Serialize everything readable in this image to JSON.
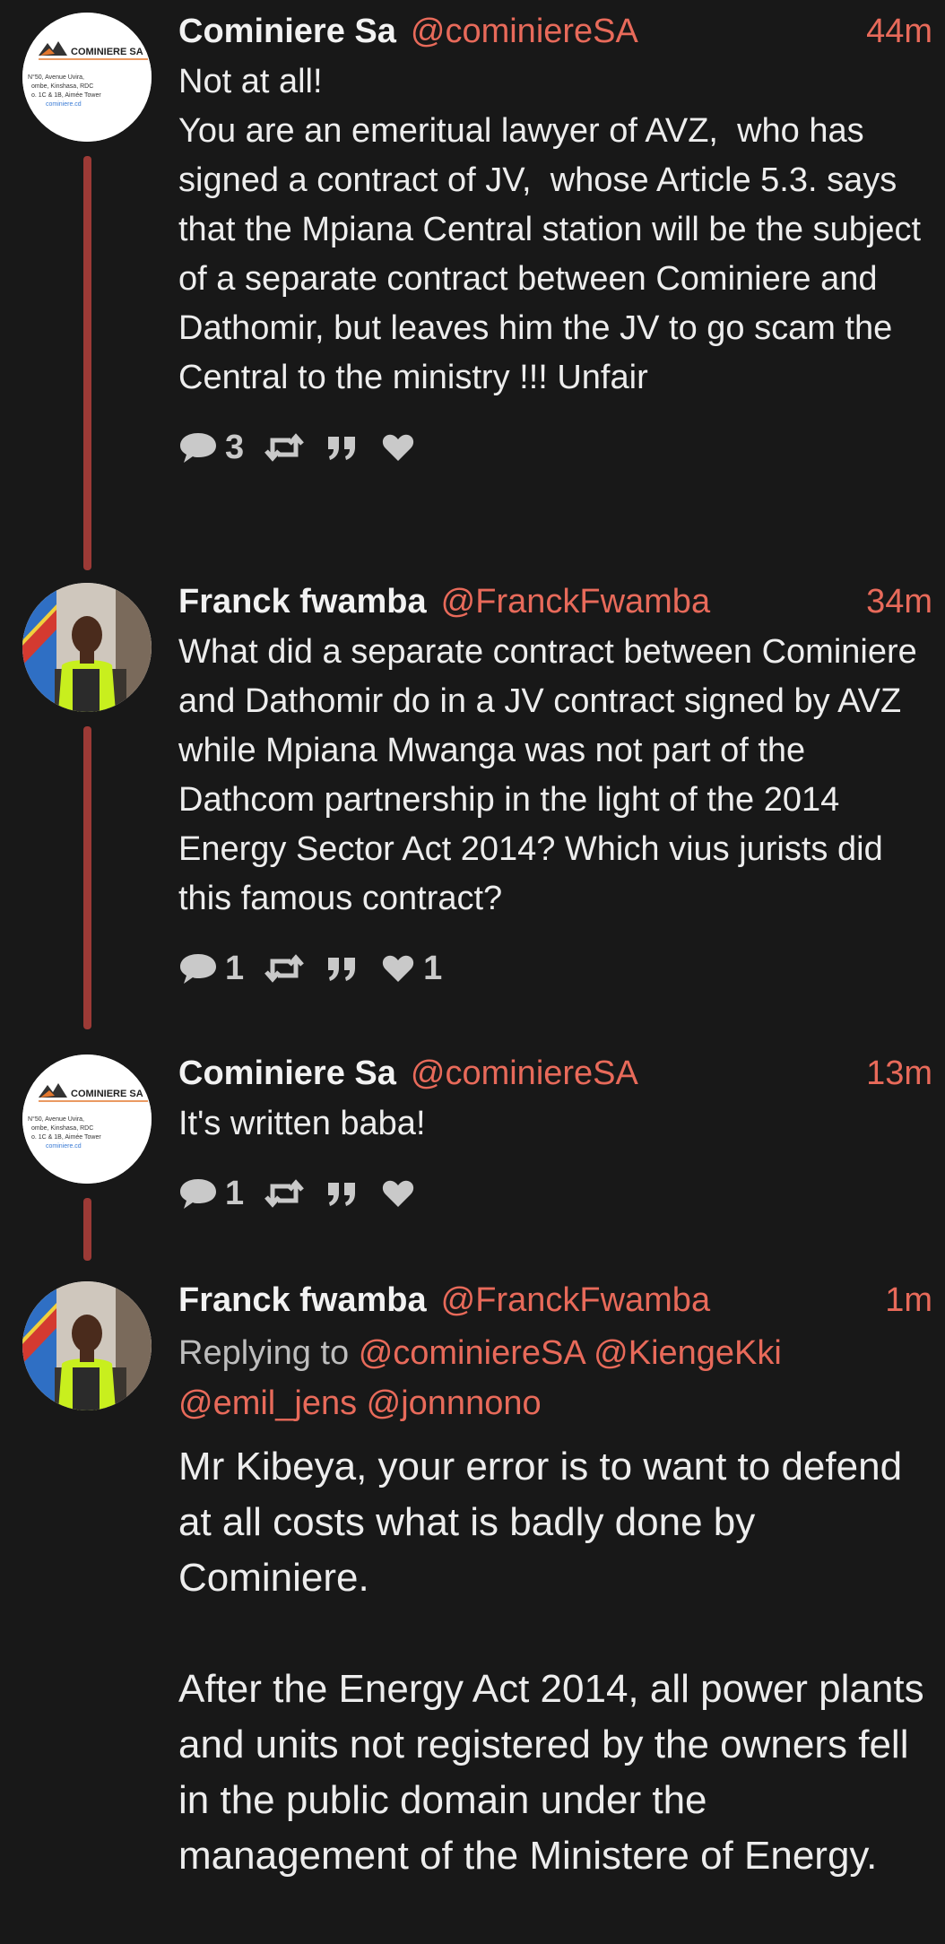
{
  "tweets": [
    {
      "name": "Cominiere Sa",
      "handle": "@cominiereSA",
      "time": "44m",
      "text": "Not at all!\nYou are an emeritual lawyer of AVZ,  who has signed a contract of JV,  whose Article 5.3. says that the Mpiana Central station will be the subject of a separate contract between Cominiere and Dathomir, but leaves him the JV to go scam the Central to the ministry !!! Unfair",
      "reply_count": "3",
      "like_count": "",
      "avatar": {
        "logo_text": "COMINIERE SA",
        "lines": [
          "N°50, Avenue Uvira,",
          "ombe, Kinshasa, RDC",
          "o. 1C & 1B, Aimée Tower",
          "cominiere.cd"
        ]
      }
    },
    {
      "name": "Franck fwamba",
      "handle": "@FranckFwamba",
      "time": "34m",
      "text": "What did a separate contract between Cominiere and Dathomir do in a JV contract signed by AVZ while Mpiana Mwanga was not part of the Dathcom partnership in the light of the 2014 Energy Sector Act 2014? Which vius jurists did this famous contract?",
      "reply_count": "1",
      "like_count": "1"
    },
    {
      "name": "Cominiere Sa",
      "handle": "@cominiereSA",
      "time": "13m",
      "text": "It's written baba!",
      "reply_count": "1",
      "like_count": "",
      "avatar": {
        "logo_text": "COMINIERE SA",
        "lines": [
          "N°50, Avenue Uvira,",
          "ombe, Kinshasa, RDC",
          "o. 1C & 1B, Aimée Tower",
          "cominiere.cd"
        ]
      }
    },
    {
      "name": "Franck fwamba",
      "handle": "@FranckFwamba",
      "time": "1m",
      "replying_prefix": "Replying to",
      "replying_line1": "@cominiereSA @KiengeKki",
      "replying_line2": "@emil_jens @jonnnono",
      "text": "Mr Kibeya, your error is to want to defend at all costs what is badly done by Cominiere.\n\nAfter the Energy Act 2014, all power plants and units not registered by the owners fell in the public domain under the management of the Ministere of Energy."
    }
  ],
  "colors": {
    "background": "#181818",
    "accent": "#e86a5a",
    "thread_line": "#9c3a36",
    "text": "#ededed",
    "icons": "#c9c9c9"
  },
  "icons": [
    "reply-icon",
    "retweet-icon",
    "quote-icon",
    "like-icon"
  ]
}
